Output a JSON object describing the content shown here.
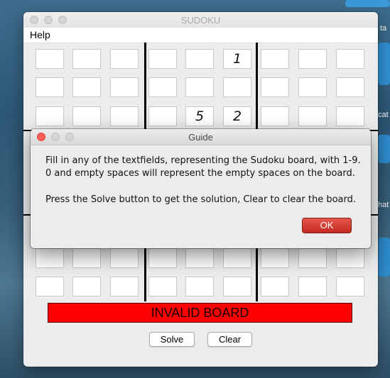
{
  "window": {
    "title": "SUDOKU"
  },
  "menu": {
    "help_label": "Help"
  },
  "board": {
    "cells": [
      [
        "",
        "",
        "",
        "",
        "",
        "1",
        "",
        "",
        ""
      ],
      [
        "",
        "",
        "",
        "",
        "",
        "",
        "",
        "",
        ""
      ],
      [
        "",
        "",
        "",
        "",
        "5",
        "2",
        "",
        "",
        ""
      ],
      [
        "",
        "",
        "",
        "",
        "",
        "",
        "",
        "",
        ""
      ],
      [
        "",
        "",
        "",
        "",
        "",
        "",
        "",
        "",
        ""
      ],
      [
        "",
        "",
        "",
        "",
        "",
        "",
        "",
        "",
        ""
      ],
      [
        "",
        "",
        "",
        "",
        "",
        "",
        "",
        "",
        ""
      ],
      [
        "",
        "",
        "",
        "",
        "",
        "",
        "",
        "",
        ""
      ],
      [
        "",
        "",
        "",
        "",
        "",
        "",
        "",
        "",
        ""
      ]
    ]
  },
  "status": {
    "text": "INVALID BOARD",
    "color": "#ff0000"
  },
  "buttons": {
    "solve_label": "Solve",
    "clear_label": "Clear"
  },
  "dialog": {
    "title": "Guide",
    "lines": [
      "Fill in any of the textfields, representing the Sudoku board, with 1-9.",
      "0 and empty spaces will represent the empty spaces on the board.",
      "Press the Solve button to get the solution, Clear to clear the board."
    ],
    "ok_label": "OK",
    "ok_color": "#d63c33"
  },
  "desktop": {
    "snippets": [
      "ta",
      "cat",
      "hat"
    ]
  }
}
